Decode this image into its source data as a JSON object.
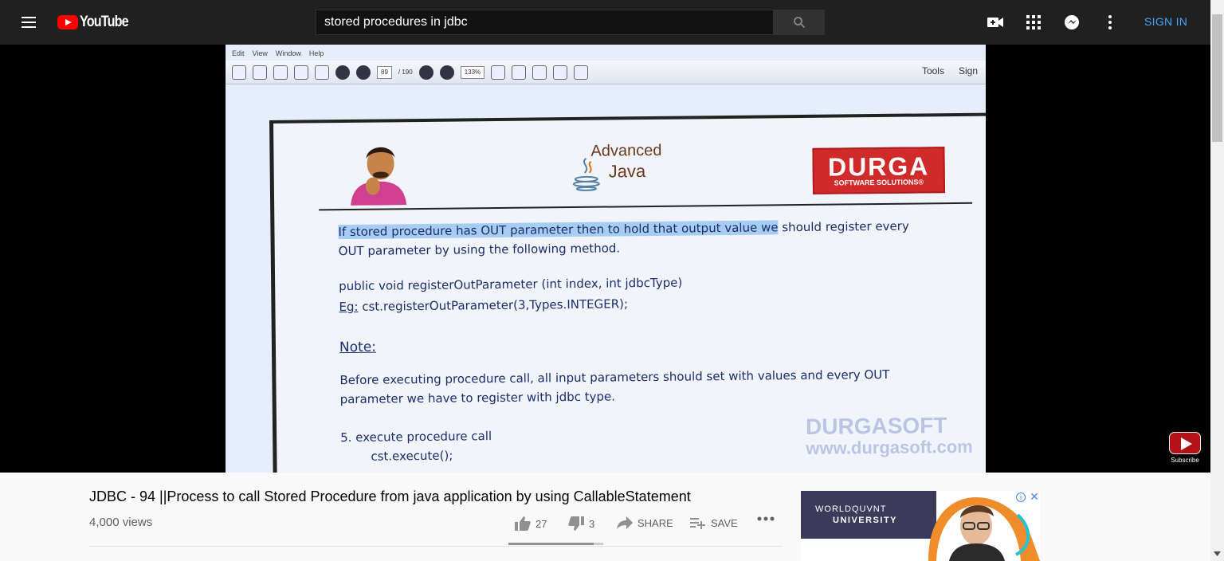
{
  "header": {
    "logo_text": "YouTube",
    "search_value": "stored procedures in jdbc",
    "signin_label": "SIGN IN",
    "icons": [
      "menu-icon",
      "search-icon",
      "create-video-icon",
      "apps-grid-icon",
      "messages-icon",
      "more-vert-icon"
    ]
  },
  "pdf": {
    "menus": [
      "Edit",
      "View",
      "Window",
      "Help"
    ],
    "page_current": "89",
    "page_total": "/ 190",
    "zoom": "133%",
    "tools_label": "Tools",
    "sign_label": "Sign"
  },
  "slide": {
    "advanced": "Advanced",
    "java": "Java",
    "durga": "DURGA",
    "durga_sub": "SOFTWARE SOLUTIONS®",
    "line1_hl": "If stored procedure has OUT parameter then to hold that output value we",
    "line1_rest": " should register every",
    "line2": "OUT parameter by using the following method.",
    "method": "public  void registerOutParameter (int index, int jdbcType)",
    "eg_label": "Eg:",
    "eg_code": " cst.registerOutParameter(3,Types.INTEGER);",
    "note": "Note:",
    "note1": "Before executing procedure call, all input parameters should set with values and every OUT",
    "note2": "parameter we have to register with jdbc type.",
    "step5": "5. execute procedure call",
    "step5_code": "cst.execute();",
    "watermark1": "DURGASOFT",
    "watermark2": "www.durgasoft.com"
  },
  "player": {
    "subscribe_label": "Subscribe"
  },
  "video": {
    "title": "JDBC - 94 ||Process to call Stored Procedure from java application by using CallableStatement",
    "views": "4,000 views",
    "likes": "27",
    "dislikes": "3",
    "share_label": "SHARE",
    "save_label": "SAVE",
    "like_ratio": 0.9
  },
  "ad": {
    "line1": "WORLDQUVNT",
    "line2": "UNIVERSITY"
  }
}
